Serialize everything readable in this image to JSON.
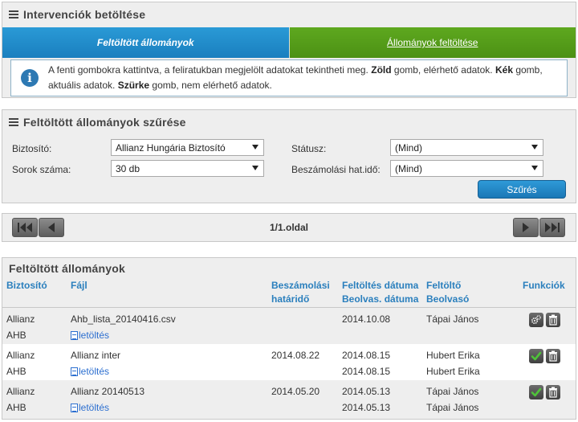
{
  "upload_panel": {
    "title": "Intervenciók betöltése",
    "tab_uploaded": "Feltöltött állományok",
    "tab_upload": "Állományok feltöltése",
    "info_part1": "A fenti gombokra kattintva, a feliratukban megjelölt adatokat tekintheti meg. ",
    "info_green": "Zöld",
    "info_part2": " gomb, elérhető adatok. ",
    "info_blue": "Kék",
    "info_part3": " gomb,",
    "info_part4": "aktuális adatok. ",
    "info_grey": "Szürke",
    "info_part5": " gomb, nem elérhető adatok."
  },
  "filter_panel": {
    "title": "Feltöltött állományok szűrése",
    "insurer_label": "Biztosító:",
    "insurer_value": "Allianz Hungária Biztosító",
    "rows_label": "Sorok száma:",
    "rows_value": "30 db",
    "status_label": "Státusz:",
    "status_value": "(Mind)",
    "deadline_label": "Beszámolási hat.idő:",
    "deadline_value": "(Mind)",
    "filter_button": "Szűrés"
  },
  "pager": {
    "page_text": "1/1.oldal"
  },
  "table": {
    "title": "Feltöltött állományok",
    "headers": {
      "insurer": "Biztosító",
      "file": "Fájl",
      "deadline_1": "Beszámolási",
      "deadline_2": "határidő",
      "upload_date_1": "Feltöltés dátuma",
      "upload_date_2": "Beolvas. dátuma",
      "uploader_1": "Feltöltő",
      "uploader_2": "Beolvasó",
      "functions": "Funkciók"
    },
    "rows": [
      {
        "insurer_1": "Allianz",
        "insurer_2": "AHB",
        "file": "Ahb_lista_20140416.csv",
        "download": "letöltés",
        "deadline": "",
        "upload_date": "2014.10.08",
        "read_date": "",
        "uploader": "Tápai János",
        "reader": ""
      },
      {
        "insurer_1": "Allianz",
        "insurer_2": "AHB",
        "file": "Allianz inter",
        "download": "letöltés",
        "deadline": "2014.08.22",
        "upload_date": "2014.08.15",
        "read_date": "2014.08.15",
        "uploader": "Hubert Erika",
        "reader": "Hubert Erika"
      },
      {
        "insurer_1": "Allianz",
        "insurer_2": "AHB",
        "file": "Allianz 20140513",
        "download": "letöltés",
        "deadline": "2014.05.20",
        "upload_date": "2014.05.13",
        "read_date": "2014.05.13",
        "uploader": "Tápai János",
        "reader": "Tápai János"
      }
    ]
  },
  "colors": {
    "accent_blue": "#1a7fbf",
    "accent_green": "#4c9114",
    "link_blue": "#2c6fd0",
    "header_blue": "#2a7fbd"
  },
  "icons": {
    "menu": "hamburger-icon",
    "info": "info-icon",
    "first": "first-page-icon",
    "prev": "prev-page-icon",
    "next": "next-page-icon",
    "last": "last-page-icon",
    "process": "gears-icon",
    "ok": "checkmark-icon",
    "delete": "trash-icon",
    "file": "file-icon"
  }
}
